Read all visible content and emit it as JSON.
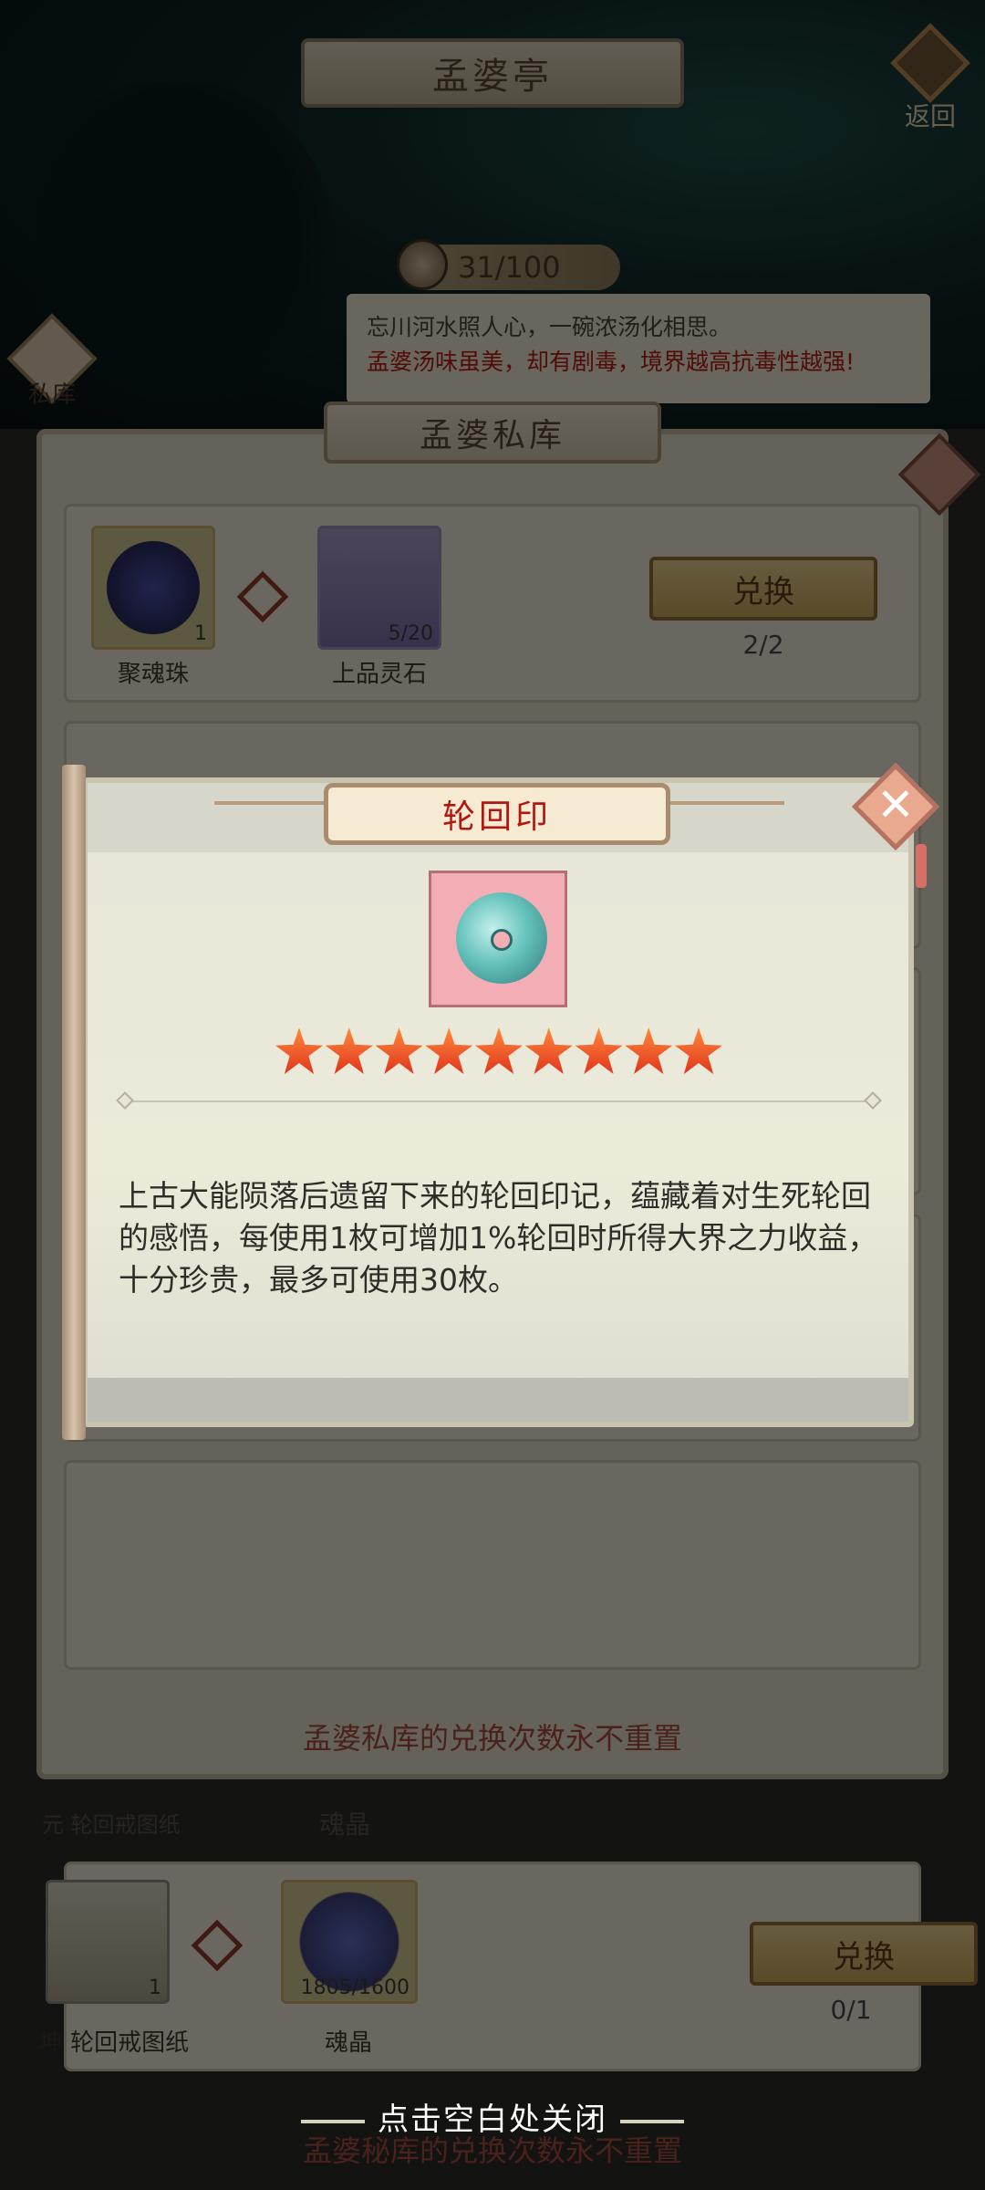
{
  "header": {
    "title": "孟婆亭",
    "back_label": "返回",
    "soup_counter": "31/100",
    "description_line1": "忘川河水照人心，一碗浓汤化相思。",
    "description_line2": "孟婆汤味虽美，却有剧毒，境界越高抗毒性越强!",
    "private_button_label": "私库"
  },
  "storage": {
    "title": "孟婆私库",
    "rows": [
      {
        "item1_name": "聚魂珠",
        "item1_count": "1",
        "item2_name": "上品灵石",
        "item2_count": "5/20",
        "button_label": "兑换",
        "exchange_count": "2/2"
      },
      {
        "item1_name": "坤 轮回戒图纸",
        "item1_count": "1",
        "item2_name": "魂晶",
        "item2_count": "1805/1600",
        "button_label": "兑换",
        "exchange_count": "0/1"
      }
    ],
    "behind_item_label": "元 轮回戒图纸",
    "behind_item2_label": "魂晶",
    "footer_note": "孟婆私库的兑换次数永不重置",
    "bottom_note": "孟婆秘库的兑换次数永不重置"
  },
  "popup": {
    "title": "轮回印",
    "star_count": 9,
    "description": "上古大能陨落后遗留下来的轮回印记，蕴藏着对生死轮回的感悟，每使用1枚可增加1%轮回时所得大界之力收益，十分珍贵，最多可使用30枚。",
    "close_hint": "点击空白处关闭"
  },
  "colors": {
    "popup_title": "#b3150f",
    "warning_text": "#b01c12",
    "star": "#e0331b"
  }
}
